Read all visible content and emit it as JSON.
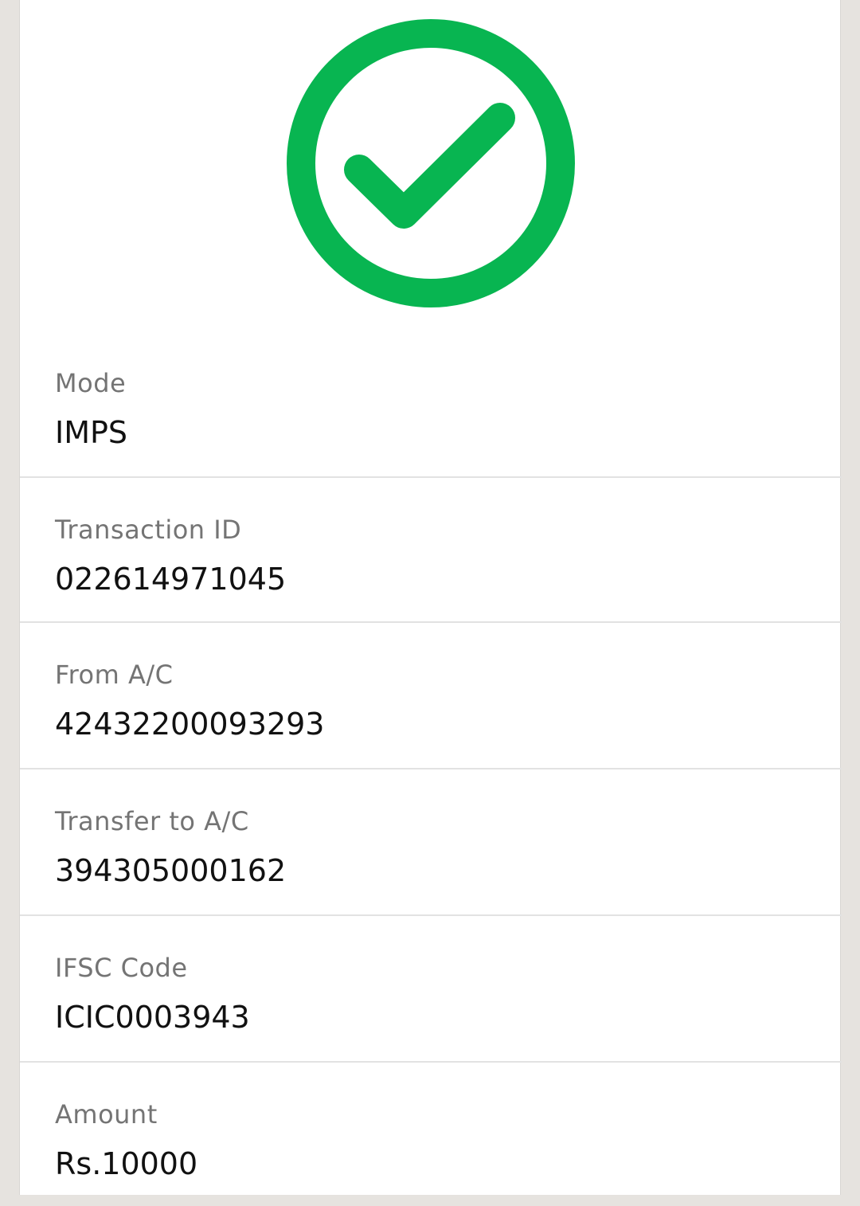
{
  "status": {
    "icon": "check-circle-icon",
    "color": "#08b551"
  },
  "details": [
    {
      "label": "Mode",
      "value": "IMPS"
    },
    {
      "label": "Transaction ID",
      "value": "022614971045"
    },
    {
      "label": "From A/C",
      "value": "42432200093293"
    },
    {
      "label": "Transfer to A/C",
      "value": "394305000162"
    },
    {
      "label": "IFSC Code",
      "value": "ICIC0003943"
    },
    {
      "label": "Amount",
      "value": "Rs.10000"
    }
  ]
}
